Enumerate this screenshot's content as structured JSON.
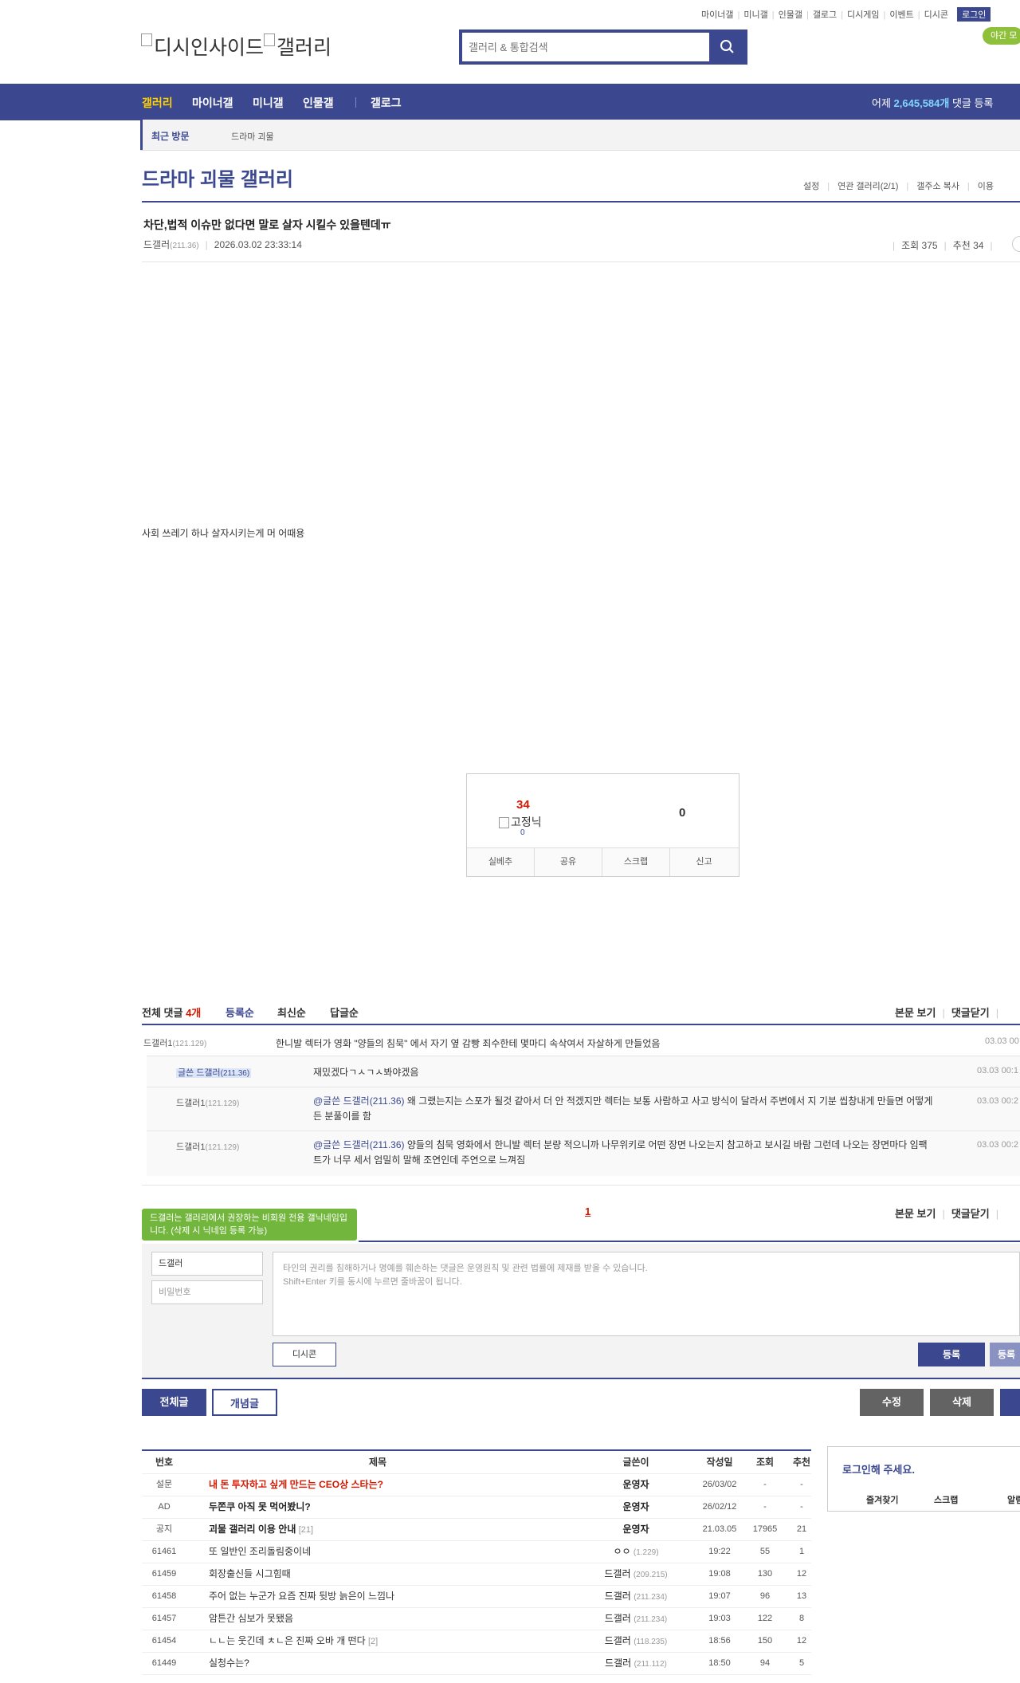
{
  "topmenu": [
    "마이너갤",
    "미니갤",
    "인물갤",
    "갤로그",
    "디시게임",
    "이벤트",
    "디시콘"
  ],
  "login_label": "로그인",
  "night_label": "야간 모",
  "logo_alt_1": "디시인사이드",
  "logo_alt_2": "갤러리",
  "search": {
    "placeholder": "갤러리 & 통합검색"
  },
  "nav": {
    "items": [
      "갤러리",
      "마이너갤",
      "미니갤",
      "인물갤",
      "갤로그"
    ],
    "stat_prefix": "어제 ",
    "stat_value": "2,645,584개",
    "stat_suffix": " 댓글 등록"
  },
  "recent": {
    "label": "최근 방문",
    "item": "드라마 괴물"
  },
  "gallery": {
    "title": "드라마 괴물 갤러리",
    "options": [
      "설정",
      "연관 갤러리(2/1)",
      "갤주소 복사",
      "이용"
    ]
  },
  "post": {
    "title": "차단,법적 이슈만 없다면 말로 살자 시킬수 있을텐데ㅠ",
    "writer": "드갤러",
    "ip": "(211.36)",
    "date": "2026.03.02 23:33:14",
    "views": "조회 375",
    "recommends": "추천 34",
    "body": "사회 쓰레기 하나 살자시키는게 머 어때용"
  },
  "recommend_box": {
    "up": "34",
    "fixnick_alt": "고정닉",
    "fixnick_count": "0",
    "down": "0",
    "buttons": [
      "실베추",
      "공유",
      "스크랩",
      "신고"
    ]
  },
  "comments_header": {
    "label": "전체 댓글 ",
    "count": "4개",
    "sorts": [
      "등록순",
      "최신순",
      "답글순"
    ],
    "right": [
      "본문 보기",
      "댓글닫기"
    ]
  },
  "comments": [
    {
      "nick": "드갤러1",
      "ip": "(121.129)",
      "text": "한니발 렉터가 영화 \"양들의 침묵\" 에서 자기 옆 감빵 죄수한테 몇마디 속삭여서 자살하게 만들었음",
      "date": "03.03 00"
    },
    {
      "nick": "글쓴 드갤러",
      "ip": "(211.36)",
      "text": "재밌겠다ㄱㅅㄱㅅ봐야겠음",
      "date": "03.03 00:1"
    },
    {
      "nick": "드갤러1",
      "ip": "(121.129)",
      "mention": "@글쓴 드갤러(211.36)",
      "text": " 왜 그랬는지는 스포가 될것 같아서 더 안 적겠지만 렉터는 보통 사람하고 사고 방식이 달라서 주변에서 지 기분 씹창내게 만들면 어떻게든 분풀이를 함",
      "date": "03.03 00:2"
    },
    {
      "nick": "드갤러1",
      "ip": "(121.129)",
      "mention": "@글쓴 드갤러(211.36)",
      "text": " 양들의 침묵 영화에서 한니발 렉터 분량 적으니까 나무위키로 어떤 장면 나오는지 참고하고 보시길 바람 그런데 나오는 장면마다 임팩트가 너무 세서 엄밀히 말해 조연인데 주연으로 느껴짐",
      "date": "03.03 00:2"
    }
  ],
  "pager": {
    "current": "1"
  },
  "write": {
    "tip": "드갤러는 갤러리에서 권장하는 비회원 전용 갤닉네임입니다. (삭제 시 닉네임 등록 가능)",
    "name": "드갤러",
    "password_placeholder": "비밀번호",
    "textarea_line1": "타인의 권리를 침해하거나 명예를 훼손하는 댓글은 운영원칙 및 관련 법률에 제재를 받을 수 있습니다.",
    "textarea_line2": "Shift+Enter 키를 동시에 누르면 줄바꿈이 됩니다.",
    "dccon": "디시콘",
    "submit": "등록",
    "submit2": "등록"
  },
  "bottom": {
    "tabs": [
      "전체글",
      "개념글"
    ],
    "edit": "수정",
    "delete": "삭제"
  },
  "list": {
    "headers": [
      "번호",
      "제목",
      "글쓴이",
      "작성일",
      "조회",
      "추천"
    ],
    "rows": [
      {
        "no": "설문",
        "title": "내 돈 투자하고 싶게 만드는 CEO상 스타는?",
        "comments": "",
        "writer": "운영자",
        "ip": "",
        "date": "26/03/02",
        "views": "-",
        "rec": "-",
        "style": "red"
      },
      {
        "no": "AD",
        "title": "두쫀쿠 아직 못 먹어봤니?",
        "comments": "",
        "writer": "운영자",
        "ip": "",
        "date": "26/02/12",
        "views": "-",
        "rec": "-",
        "style": "bold"
      },
      {
        "no": "공지",
        "title": "괴물 갤러리 이용 안내",
        "comments": "[21]",
        "writer": "운영자",
        "ip": "",
        "date": "21.03.05",
        "views": "17965",
        "rec": "21",
        "style": "bold"
      },
      {
        "no": "61461",
        "title": "또 일반인 조리돌림중이네",
        "comments": "",
        "writer": "ㅇㅇ",
        "ip": "(1.229)",
        "date": "19:22",
        "views": "55",
        "rec": "1",
        "style": ""
      },
      {
        "no": "61459",
        "title": "회장출신들 시그힘때",
        "comments": "",
        "writer": "드갤러",
        "ip": "(209.215)",
        "date": "19:08",
        "views": "130",
        "rec": "12",
        "style": ""
      },
      {
        "no": "61458",
        "title": "주어 없는 누군가 요즘 진짜 뒷방 늙은이 느낌나",
        "comments": "",
        "writer": "드갤러",
        "ip": "(211.234)",
        "date": "19:07",
        "views": "96",
        "rec": "13",
        "style": ""
      },
      {
        "no": "61457",
        "title": "암튼간 심보가 못됐음",
        "comments": "",
        "writer": "드갤러",
        "ip": "(211.234)",
        "date": "19:03",
        "views": "122",
        "rec": "8",
        "style": ""
      },
      {
        "no": "61454",
        "title": "ㄴㄴ는 웃긴데 ㅊㄴ은 진짜 오바 개 떤다",
        "comments": "[2]",
        "writer": "드갤러",
        "ip": "(118.235)",
        "date": "18:56",
        "views": "150",
        "rec": "12",
        "style": ""
      },
      {
        "no": "61449",
        "title": "실청수는?",
        "comments": "",
        "writer": "드갤러",
        "ip": "(211.112)",
        "date": "18:50",
        "views": "94",
        "rec": "5",
        "style": ""
      }
    ]
  },
  "side": {
    "title": "로그인해 주세요.",
    "buttons": [
      "즐겨찾기",
      "스크랩",
      "알림"
    ]
  }
}
